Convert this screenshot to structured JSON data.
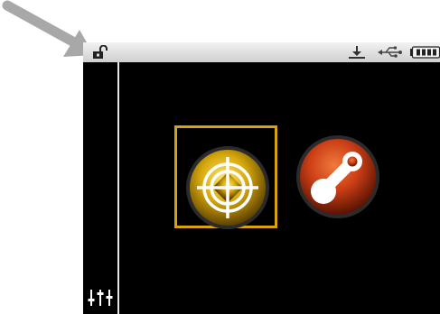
{
  "screen": "home",
  "status_bar": {
    "icons": [
      "unlocked-padlock-icon",
      "download-icon",
      "usb-icon",
      "battery-icon"
    ]
  },
  "sidebar": {
    "icon": "equalizer-sliders-icon"
  },
  "apps": [
    {
      "icon": "crosshair-target-icon",
      "color": "#d8a20f",
      "selected": true
    },
    {
      "icon": "linked-nodes-icon",
      "color": "#d2461a",
      "selected": false
    }
  ],
  "annotation": {
    "icon": "arrow-icon",
    "color": "#a8a8a8",
    "points_to": "lock-icon"
  },
  "colors": {
    "selection": "#d8a20f",
    "screen_bg": "#000000",
    "status_bar": "#e0e0e0"
  }
}
